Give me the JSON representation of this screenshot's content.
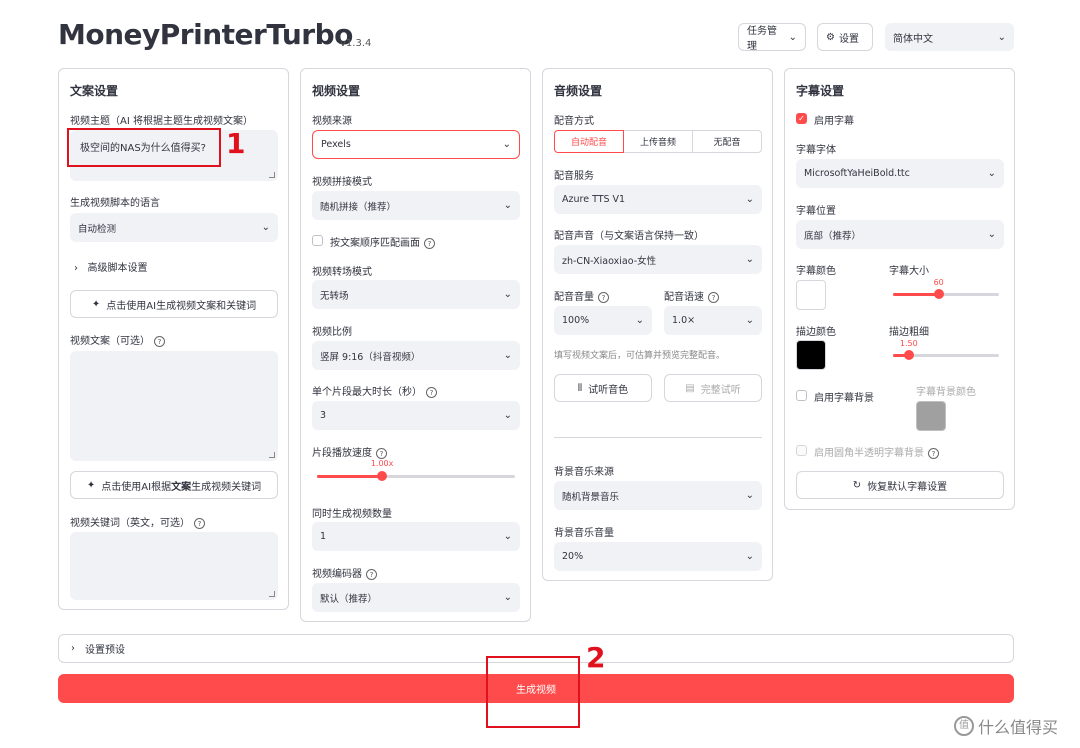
{
  "header": {
    "title": "MoneyPrinterTurbo",
    "version": "v1.3.4",
    "task_mgmt": "任务管理",
    "settings": "设置",
    "language": "简体中文"
  },
  "script_panel": {
    "title": "文案设置",
    "topic_label": "视频主题（AI 将根据主题生成视频文案）",
    "topic_value": "极空间的NAS为什么值得买?",
    "lang_label": "生成视频脚本的语言",
    "lang_value": "自动检测",
    "advanced": "高级脚本设置",
    "gen_script_btn": "点击使用AI生成视频文案和关键词",
    "script_label": "视频文案（可选）",
    "gen_kw_btn_pre": "点击使用AI根据",
    "gen_kw_btn_bold": "文案",
    "gen_kw_btn_post": "生成视频关键词",
    "keywords_label": "视频关键词（英文，可选）"
  },
  "video_panel": {
    "title": "视频设置",
    "source_label": "视频来源",
    "source_value": "Pexels",
    "concat_label": "视频拼接模式",
    "concat_value": "随机拼接（推荐）",
    "match_label": "按文案顺序匹配画面",
    "transition_label": "视频转场模式",
    "transition_value": "无转场",
    "ratio_label": "视频比例",
    "ratio_value": "竖屏 9:16（抖音视频）",
    "clip_label": "单个片段最大时长（秒）",
    "clip_value": "3",
    "speed_label": "片段播放速度",
    "speed_value": "1.00x",
    "speed_fraction": 0.33,
    "count_label": "同时生成视频数量",
    "count_value": "1",
    "codec_label": "视频编码器",
    "codec_value": "默认（推荐）"
  },
  "audio_panel": {
    "title": "音频设置",
    "dub_label": "配音方式",
    "dub_options": [
      "自动配音",
      "上传音频",
      "无配音"
    ],
    "service_label": "配音服务",
    "service_value": "Azure TTS V1",
    "voice_label": "配音声音（与文案语言保持一致）",
    "voice_value": "zh-CN-Xiaoxiao-女性",
    "volume_label": "配音音量",
    "volume_value": "100%",
    "rate_label": "配音语速",
    "rate_value": "1.0×",
    "hint": "填写视频文案后，可估算并预览完整配音。",
    "preview_btn": "试听音色",
    "full_btn": "完整试听",
    "bgm_source_label": "背景音乐来源",
    "bgm_source_value": "随机背景音乐",
    "bgm_volume_label": "背景音乐音量",
    "bgm_volume_value": "20%"
  },
  "subtitle_panel": {
    "title": "字幕设置",
    "enable_label": "启用字幕",
    "font_label": "字幕字体",
    "font_value": "MicrosoftYaHeiBold.ttc",
    "position_label": "字幕位置",
    "position_value": "底部（推荐）",
    "color_label": "字幕颜色",
    "size_label": "字幕大小",
    "size_value": "60",
    "size_fraction": 0.43,
    "stroke_color_label": "描边颜色",
    "stroke_width_label": "描边粗细",
    "stroke_width_value": "1.50",
    "stroke_fraction": 0.15,
    "bg_enable_label": "启用字幕背景",
    "bg_color_label": "字幕背景颜色",
    "rounded_label": "启用圆角半透明字幕背景",
    "reset_btn": "恢复默认字幕设置",
    "colors": {
      "text": "#ffffff",
      "stroke": "#000000",
      "bg": "#a0a0a0"
    }
  },
  "footer": {
    "preset": "设置预设",
    "generate": "生成视频"
  },
  "annotations": {
    "one": "1",
    "two": "2"
  },
  "watermark": "什么值得买",
  "colors": {
    "accent": "#ff4b4b",
    "annotation": "#e0101c"
  }
}
